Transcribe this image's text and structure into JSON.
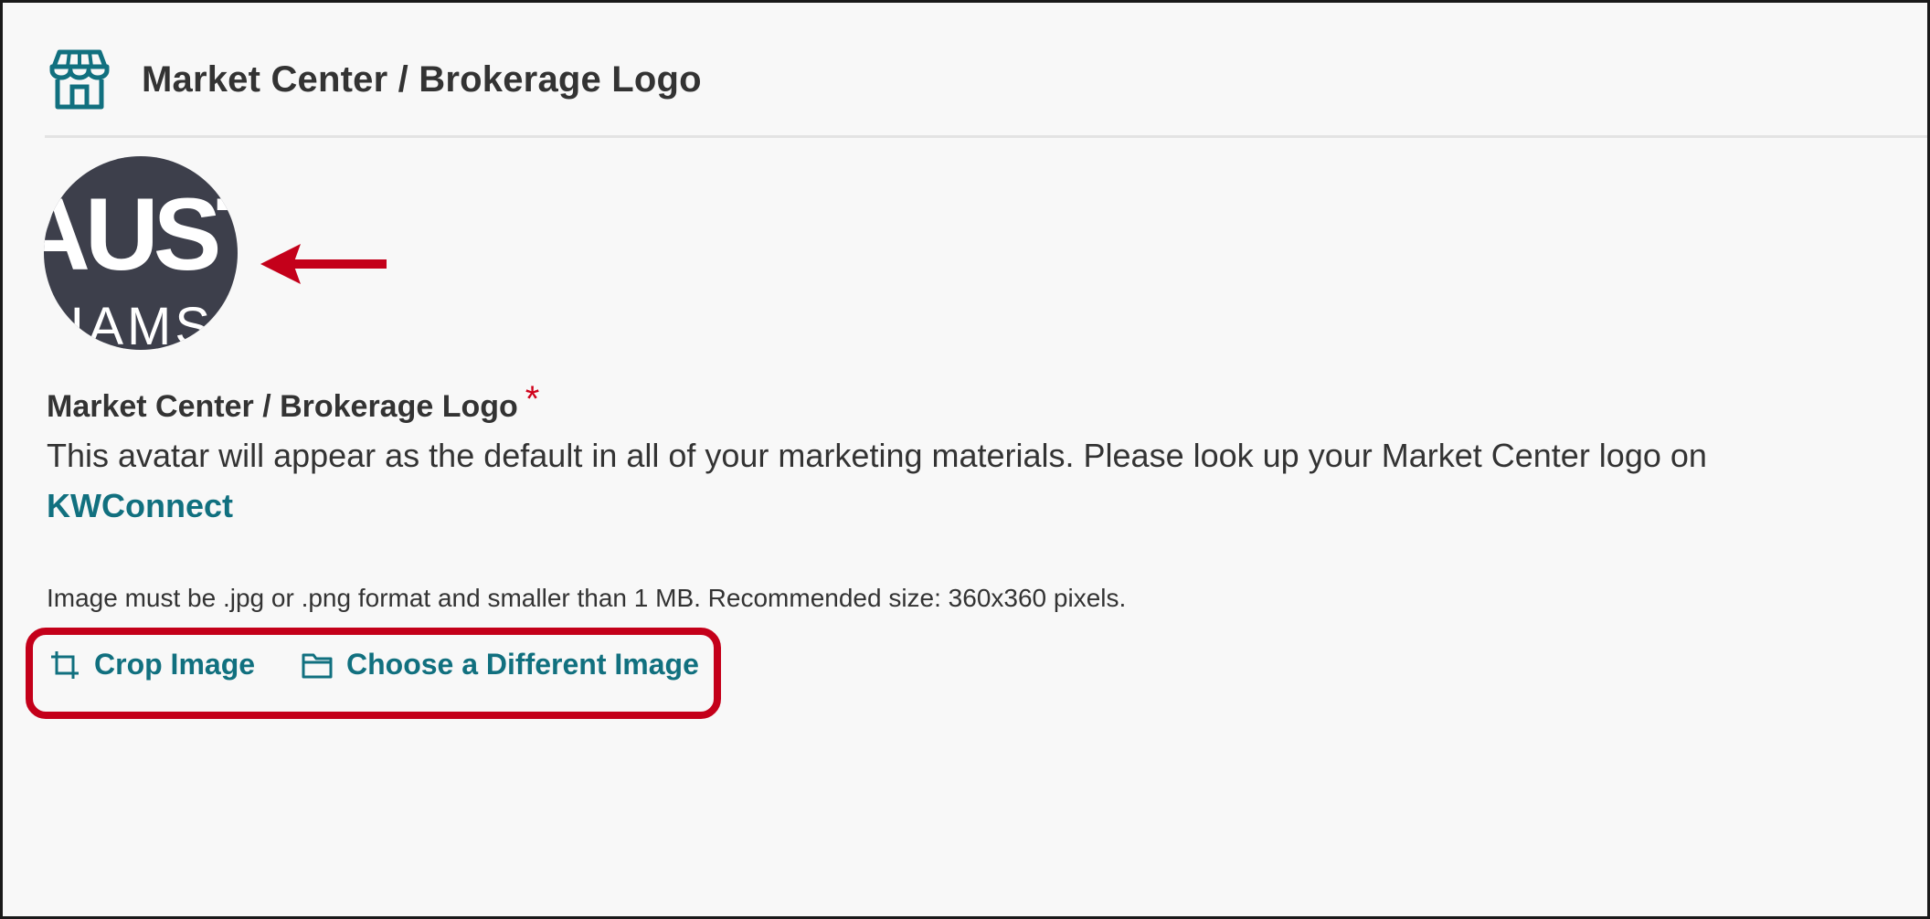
{
  "header": {
    "icon": "storefront-icon",
    "title": "Market Center / Brokerage Logo"
  },
  "avatar": {
    "text_top": "AUST",
    "text_bottom": "LIAMS"
  },
  "annotation": {
    "arrow_icon": "left-arrow-icon",
    "arrow_color": "#c4001a",
    "highlight_color": "#c4001a"
  },
  "field": {
    "label": "Market Center / Brokerage Logo",
    "required_mark": "*",
    "description": "This avatar will appear as the default in all of your marketing materials. Please look up your Market Center logo on",
    "link_text": "KWConnect",
    "hint": "Image must be .jpg or .png format and smaller than 1 MB. Recommended size: 360x360 pixels."
  },
  "actions": {
    "crop_label": "Crop Image",
    "crop_icon": "crop-icon",
    "choose_label": "Choose a Different Image",
    "choose_icon": "folder-icon"
  },
  "colors": {
    "accent": "#11707f",
    "required": "#d0021b",
    "avatar_bg": "#3d3f4b"
  }
}
